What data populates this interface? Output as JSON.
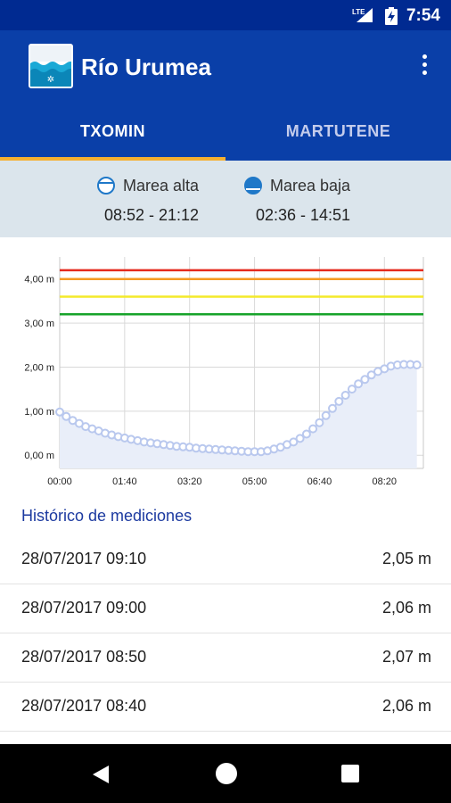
{
  "status_bar": {
    "time": "7:54",
    "network": "LTE",
    "icons": [
      "signal-icon",
      "battery-charging-icon"
    ]
  },
  "app_bar": {
    "title": "Río Urumea",
    "logo_icon": "river-logo-icon",
    "menu_icon": "overflow-menu-icon"
  },
  "tabs": [
    {
      "label": "TXOMIN",
      "selected": true
    },
    {
      "label": "MARTUTENE",
      "selected": false
    }
  ],
  "tides": {
    "high": {
      "label": "Marea alta",
      "times": "08:52 - 21:12",
      "icon": "high-tide-icon"
    },
    "low": {
      "label": "Marea baja",
      "times": "02:36 - 14:51",
      "icon": "low-tide-icon"
    }
  },
  "chart_data": {
    "type": "area",
    "title": "",
    "xlabel": "",
    "ylabel": "",
    "x_ticks": [
      "00:00",
      "01:40",
      "03:20",
      "05:00",
      "06:40",
      "08:20"
    ],
    "y_ticks": [
      "0,00 m",
      "1,00 m",
      "2,00 m",
      "3,00 m",
      "4,00 m"
    ],
    "xlim": [
      0,
      560
    ],
    "ylim": [
      -0.3,
      4.5
    ],
    "grid": true,
    "thresholds": [
      {
        "value": 4.2,
        "color": "#e52a1e"
      },
      {
        "value": 4.0,
        "color": "#f59a22"
      },
      {
        "value": 3.6,
        "color": "#f4ea2a"
      },
      {
        "value": 3.2,
        "color": "#17a32a"
      }
    ],
    "series": [
      {
        "color": "#b9c8ee",
        "fill": "#e9eef9",
        "x": [
          0,
          10,
          20,
          30,
          40,
          50,
          60,
          70,
          80,
          90,
          100,
          110,
          120,
          130,
          140,
          150,
          160,
          170,
          180,
          190,
          200,
          210,
          220,
          230,
          240,
          250,
          260,
          270,
          280,
          290,
          300,
          310,
          320,
          330,
          340,
          350,
          360,
          370,
          380,
          390,
          400,
          410,
          420,
          430,
          440,
          450,
          460,
          470,
          480,
          490,
          500,
          510,
          520,
          530,
          540,
          550
        ],
        "y": [
          0.98,
          0.88,
          0.79,
          0.72,
          0.65,
          0.6,
          0.55,
          0.5,
          0.46,
          0.42,
          0.39,
          0.36,
          0.33,
          0.3,
          0.28,
          0.26,
          0.24,
          0.22,
          0.2,
          0.19,
          0.18,
          0.16,
          0.15,
          0.14,
          0.13,
          0.12,
          0.11,
          0.1,
          0.09,
          0.08,
          0.08,
          0.08,
          0.1,
          0.14,
          0.18,
          0.24,
          0.3,
          0.38,
          0.48,
          0.6,
          0.74,
          0.9,
          1.06,
          1.22,
          1.36,
          1.5,
          1.62,
          1.72,
          1.82,
          1.9,
          1.96,
          2.02,
          2.05,
          2.06,
          2.06,
          2.05
        ]
      }
    ]
  },
  "history": {
    "title": "Histórico de mediciones",
    "rows": [
      {
        "date": "28/07/2017 09:10",
        "level": "2,05 m"
      },
      {
        "date": "28/07/2017 09:00",
        "level": "2,06 m"
      },
      {
        "date": "28/07/2017 08:50",
        "level": "2,07 m"
      },
      {
        "date": "28/07/2017 08:40",
        "level": "2,06 m"
      }
    ]
  },
  "nav_bar": {
    "icons": [
      "back-icon",
      "home-icon",
      "recents-icon"
    ]
  }
}
